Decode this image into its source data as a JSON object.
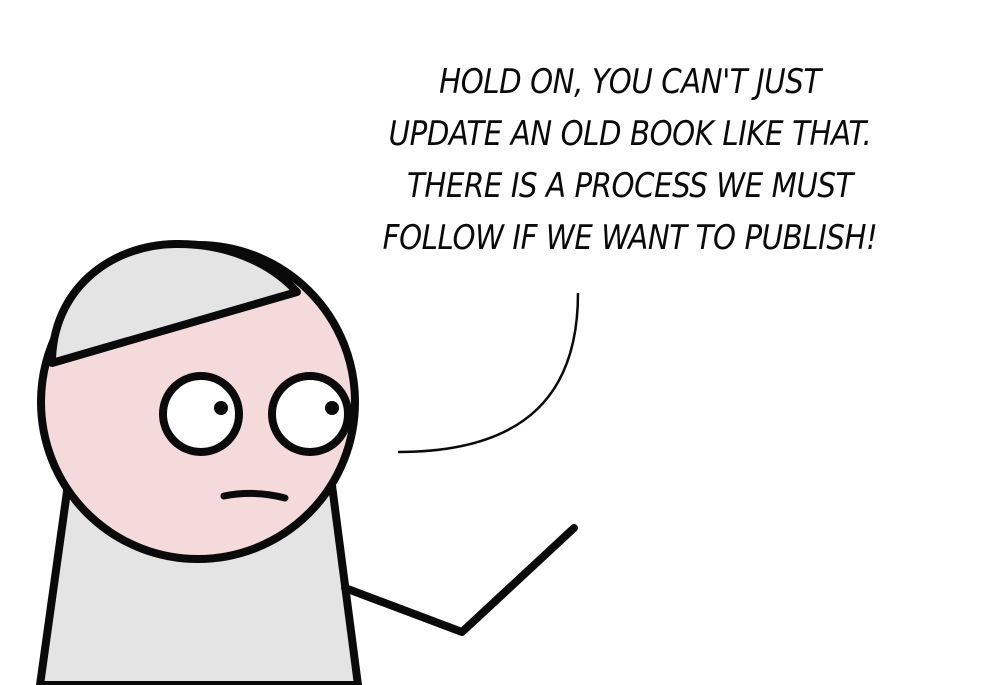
{
  "speech_bubble": {
    "lines": [
      "HOLD ON, YOU CAN'T JUST",
      "UPDATE AN OLD BOOK LIKE THAT.",
      "THERE IS A PROCESS WE MUST",
      "FOLLOW IF WE WANT TO PUBLISH!"
    ]
  },
  "colors": {
    "outline": "#0a0a0a",
    "skin": "#f4dada",
    "hood": "#e4e4e4",
    "background": "#ffffff"
  }
}
